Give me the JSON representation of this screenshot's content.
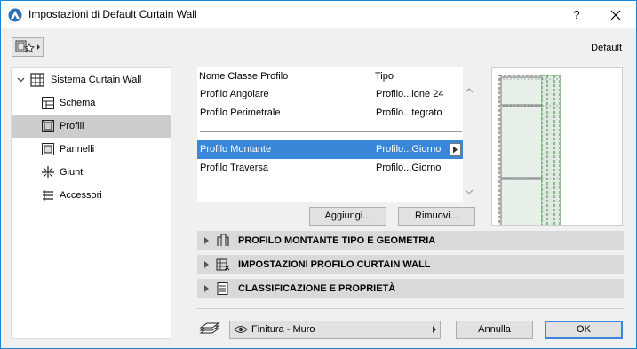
{
  "window": {
    "title": "Impostazioni di Default Curtain Wall",
    "help_label": "?",
    "close_label": "✕"
  },
  "header": {
    "default_label": "Default"
  },
  "tree": {
    "root_label": "Sistema Curtain Wall",
    "items": [
      {
        "label": "Schema",
        "icon": "schema-icon"
      },
      {
        "label": "Profili",
        "icon": "profile-icon",
        "selected": true
      },
      {
        "label": "Pannelli",
        "icon": "panel-icon"
      },
      {
        "label": "Giunti",
        "icon": "joint-icon"
      },
      {
        "label": "Accessori",
        "icon": "accessory-icon"
      }
    ]
  },
  "profile_list": {
    "col1_header": "Nome Classe Profilo",
    "col2_header": "Tipo",
    "rows": [
      {
        "name": "Profilo Angolare",
        "type": "Profilo...ione 24"
      },
      {
        "name": "Profilo Perimetrale",
        "type": "Profilo...tegrato"
      },
      {
        "name": "Profilo Montante",
        "type": "Profilo...Giorno",
        "selected": true
      },
      {
        "name": "Profilo Traversa",
        "type": "Profilo...Giorno"
      }
    ]
  },
  "buttons": {
    "add": "Aggiungi...",
    "remove": "Rimuovi...",
    "cancel": "Annulla",
    "ok": "OK"
  },
  "sections": [
    {
      "label": "PROFILO MONTANTE TIPO E GEOMETRIA",
      "icon": "profile-geometry-icon"
    },
    {
      "label": "IMPOSTAZIONI PROFILO CURTAIN WALL",
      "icon": "curtain-wall-settings-icon"
    },
    {
      "label": "CLASSIFICAZIONE E PROPRIETÀ",
      "icon": "classification-icon"
    }
  ],
  "footer": {
    "layer_value": "Finitura - Muro"
  },
  "colors": {
    "accent": "#3a86d8",
    "selected_tree": "#cccccc",
    "section_bg": "#d9d9d9"
  }
}
